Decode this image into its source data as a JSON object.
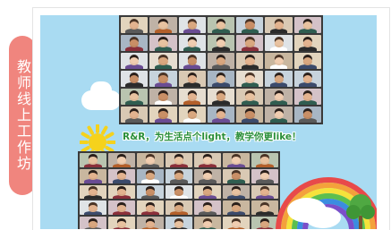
{
  "side_tab": {
    "label": "教师线上工作坊"
  },
  "poster": {
    "slogan": "R&R，为生活点个light，教学你更like！",
    "colors": {
      "sky": "#a9dbf2",
      "tab": "#f0857e",
      "slogan": "#2a8f3a",
      "sun": "#f5d21c"
    },
    "top_grid": {
      "columns": 7,
      "rows": 6
    },
    "bottom_grid": {
      "columns": 7,
      "rows": 5
    }
  }
}
